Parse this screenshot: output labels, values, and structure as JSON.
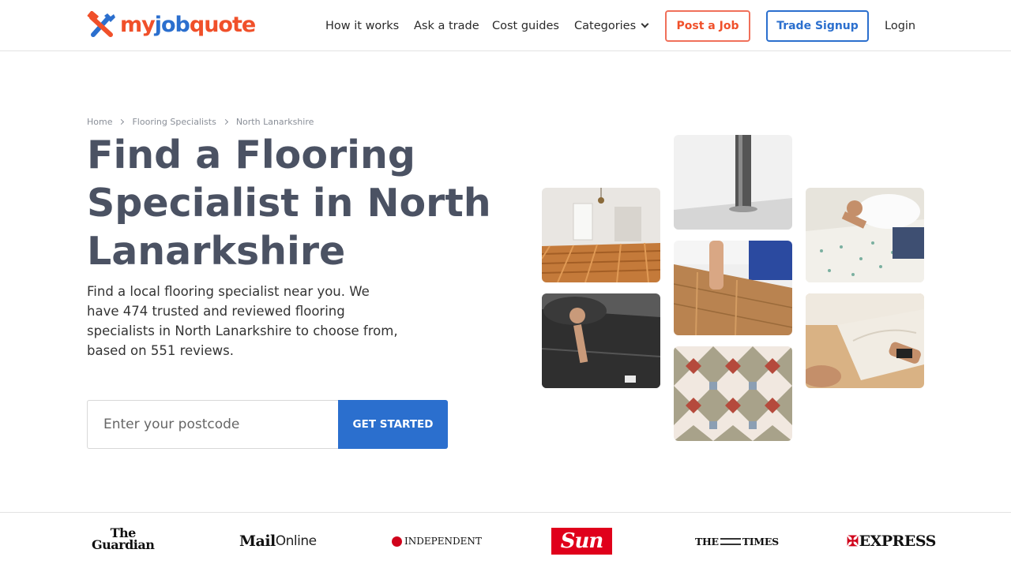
{
  "header": {
    "logo": {
      "part1": "my",
      "part2": "job",
      "part3": "quote"
    },
    "nav": {
      "how_it_works": "How it works",
      "ask_a_trade": "Ask a trade",
      "cost_guides": "Cost guides",
      "categories": "Categories",
      "post_job": "Post a Job",
      "trade_signup": "Trade Signup",
      "login": "Login"
    }
  },
  "breadcrumb": {
    "items": [
      "Home",
      "Flooring Specialists",
      "North Lanarkshire"
    ]
  },
  "hero": {
    "title": "Find a Flooring Specialist in North Lanarkshire",
    "description": "Find a local flooring specialist near you. We have 474 trusted and reviewed flooring specialists in North Lanarkshire to choose from, based on 551 reviews."
  },
  "search": {
    "placeholder": "Enter your postcode",
    "value": "",
    "button_label": "GET STARTED"
  },
  "press": {
    "guardian_line1": "The",
    "guardian_line2": "Guardian",
    "mail_bold": "Mail",
    "mail_light": "Online",
    "independent": "INDEPENDENT",
    "sun": "Sun",
    "times_left": "THE",
    "times_right": "TIMES",
    "express": "EXPRESS"
  },
  "colors": {
    "brand_orange": "#f0502a",
    "brand_blue": "#2b6fce",
    "title_slate": "#4b5263"
  }
}
